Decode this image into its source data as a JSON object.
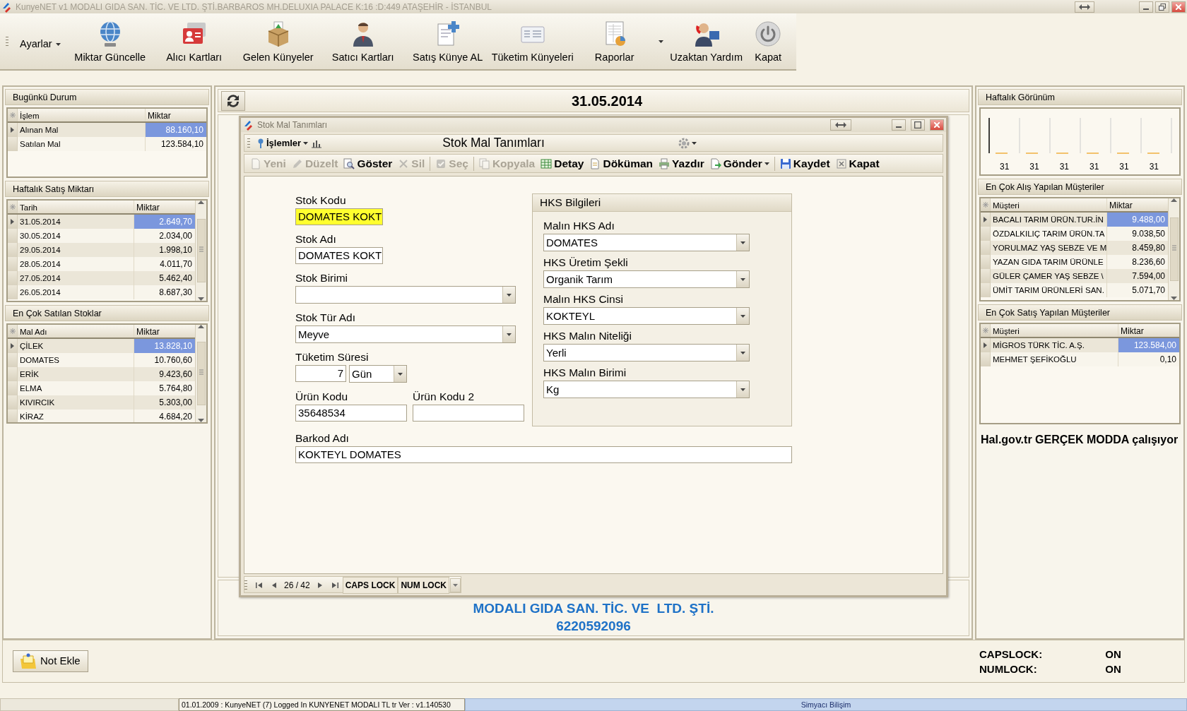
{
  "window": {
    "title": "KunyeNET v1 MODALI GIDA SAN. TİC. VE  LTD. ŞTİ.BARBAROS MH.DELUXIA PALACE K:16 :D:449 ATAŞEHİR - İSTANBUL"
  },
  "toolbar": {
    "menu": "Ayarlar",
    "buttons": [
      {
        "label": "Miktar Güncelle",
        "dropdown": false
      },
      {
        "label": "Alıcı Kartları",
        "dropdown": false
      },
      {
        "label": "Gelen Künyeler",
        "dropdown": false
      },
      {
        "label": "Satıcı Kartları",
        "dropdown": false
      },
      {
        "label": "Satış Künye AL",
        "dropdown": false
      },
      {
        "label": "Tüketim Künyeleri",
        "dropdown": false
      },
      {
        "label": "Raporlar",
        "dropdown": true
      },
      {
        "label": "Uzaktan Yardım",
        "dropdown": false
      },
      {
        "label": "Kapat",
        "dropdown": false
      }
    ]
  },
  "left_panels": [
    {
      "title": "Bugünkü Durum",
      "kind": "plain",
      "columns": [
        "İşlem",
        "Miktar"
      ],
      "rows": [
        {
          "cells": [
            "Alınan Mal",
            "88.160,10"
          ],
          "selected": true
        },
        {
          "cells": [
            "Satılan Mal",
            "123.584,10"
          ],
          "selected": false
        }
      ]
    },
    {
      "title": "Haftalık Satış Miktarı",
      "kind": "scrolled",
      "columns": [
        "Tarih",
        "Miktar"
      ],
      "rows": [
        {
          "cells": [
            "31.05.2014",
            "2.649,70"
          ],
          "selected": true
        },
        {
          "cells": [
            "30.05.2014",
            "2.034,00"
          ],
          "selected": false
        },
        {
          "cells": [
            "29.05.2014",
            "1.998,10"
          ],
          "selected": false
        },
        {
          "cells": [
            "28.05.2014",
            "4.011,70"
          ],
          "selected": false
        },
        {
          "cells": [
            "27.05.2014",
            "5.462,40"
          ],
          "selected": false
        },
        {
          "cells": [
            "26.05.2014",
            "8.687,30"
          ],
          "selected": false
        }
      ]
    },
    {
      "title": "En Çok Satılan Stoklar",
      "kind": "scrolled",
      "columns": [
        "Mal Adı",
        "Miktar"
      ],
      "rows": [
        {
          "cells": [
            "ÇİLEK",
            "13.828,10"
          ],
          "selected": true
        },
        {
          "cells": [
            "DOMATES",
            "10.760,60"
          ],
          "selected": false
        },
        {
          "cells": [
            "ERİK",
            "9.423,60"
          ],
          "selected": false
        },
        {
          "cells": [
            "ELMA",
            "5.764,80"
          ],
          "selected": false
        },
        {
          "cells": [
            "KIVIRCIK",
            "5.303,00"
          ],
          "selected": false
        },
        {
          "cells": [
            "KİRAZ",
            "4.684,20"
          ],
          "selected": false
        }
      ]
    }
  ],
  "center": {
    "date": "31.05.2014",
    "company": "MODALI GIDA SAN. TİC. VE  LTD. ŞTİ.",
    "phone": "6220592096"
  },
  "dialog": {
    "title": "Stok Mal Tanımları",
    "menu": "İşlemler",
    "heading": "Stok Mal Tanımları",
    "action_groups": [
      [
        {
          "label": "Yeni",
          "disabled": true,
          "dropdown": false
        },
        {
          "label": "Düzelt",
          "disabled": true,
          "dropdown": false
        },
        {
          "label": "Göster",
          "disabled": false,
          "dropdown": false
        },
        {
          "label": "Sil",
          "disabled": true,
          "dropdown": false
        }
      ],
      [
        {
          "label": "Seç",
          "disabled": true,
          "dropdown": false
        }
      ],
      [
        {
          "label": "Kopyala",
          "disabled": true,
          "dropdown": false
        },
        {
          "label": "Detay",
          "disabled": false,
          "dropdown": false
        },
        {
          "label": "Döküman",
          "disabled": false,
          "dropdown": false
        },
        {
          "label": "Yazdır",
          "disabled": false,
          "dropdown": false
        },
        {
          "label": "Gönder",
          "disabled": false,
          "dropdown": true
        }
      ],
      [
        {
          "label": "Kaydet",
          "disabled": false,
          "dropdown": false
        },
        {
          "label": "Kapat",
          "disabled": false,
          "dropdown": false
        }
      ]
    ],
    "form": {
      "stok_kodu": {
        "label": "Stok Kodu",
        "value": "DOMATES KOKT",
        "focused": true
      },
      "stok_adi": {
        "label": "Stok Adı",
        "value": "DOMATES KOKT",
        "focused": false
      },
      "stok_birimi": {
        "label": "Stok Birimi",
        "focused": false
      },
      "stok_tur_adi": {
        "label": "Stok Tür Adı",
        "value": "Meyve",
        "focused": false
      },
      "tuketim_suresi": {
        "label": "Tüketim Süresi",
        "value": "7",
        "unit": "Gün",
        "focused": false
      },
      "urun_kodu": {
        "label": "Ürün Kodu",
        "value": "35648534",
        "focused": false
      },
      "urun_kodu_2": {
        "label": "Ürün Kodu 2",
        "focused": false
      },
      "barkod_adi": {
        "label": "Barkod Adı",
        "value": "KOKTEYL DOMATES",
        "focused": false
      }
    },
    "hks": {
      "title": "HKS Bilgileri",
      "fields": [
        {
          "label": "Malın HKS Adı",
          "value": "DOMATES"
        },
        {
          "label": "HKS Üretim Şekli",
          "value": "Organik Tarım"
        },
        {
          "label": "Malın HKS Cinsi",
          "value": "KOKTEYL"
        },
        {
          "label": "HKS Malın Niteliği",
          "value": "Yerli"
        },
        {
          "label": "HKS Malın Birimi",
          "value": "Kg"
        }
      ]
    },
    "navigator": {
      "position": "26 / 42",
      "keys": [
        "CAPS LOCK",
        "NUM LOCK"
      ]
    }
  },
  "right": {
    "weekly": {
      "title": "Haftalık Görünüm",
      "labels": [
        "31",
        "31",
        "31",
        "31",
        "31",
        "31"
      ]
    },
    "panels": [
      {
        "title": "En Çok Alış Yapılan Müşteriler",
        "kind": "scrolled",
        "columns": [
          "Müşteri",
          "Miktar"
        ],
        "rows": [
          {
            "cells": [
              "BACALI TARIM ÜRÜN.TUR.İN",
              "9.488,00"
            ],
            "selected": true
          },
          {
            "cells": [
              "ÖZDALKILIÇ TARIM ÜRÜN.TA",
              "9.038,50"
            ],
            "selected": false
          },
          {
            "cells": [
              "YORULMAZ YAŞ SEBZE VE M",
              "8.459,80"
            ],
            "selected": false
          },
          {
            "cells": [
              "YAZAN GIDA TARIM ÜRÜNLE",
              "8.236,60"
            ],
            "selected": false
          },
          {
            "cells": [
              "GÜLER ÇAMER YAŞ SEBZE \\",
              "7.594,00"
            ],
            "selected": false
          },
          {
            "cells": [
              "ÜMİT TARIM ÜRÜNLERİ SAN.",
              "5.071,70"
            ],
            "selected": false
          }
        ]
      },
      {
        "title": "En Çok Satış Yapılan Müşteriler",
        "kind": "plain",
        "columns": [
          "Müşteri",
          "Miktar"
        ],
        "rows": [
          {
            "cells": [
              "MİGROS TÜRK TİC. A.Ş.",
              "123.584,00"
            ],
            "selected": true
          },
          {
            "cells": [
              "MEHMET ŞEFİKOĞLU",
              "0,10"
            ],
            "selected": false
          }
        ]
      }
    ],
    "message": "Hal.gov.tr GERÇEK MODDA çalışıyor"
  },
  "bottom": {
    "note_button": "Not Ekle",
    "locks": [
      {
        "label": "CAPSLOCK:",
        "value": "ON"
      },
      {
        "label": "NUMLOCK:",
        "value": "ON"
      }
    ]
  },
  "status_bar": {
    "login": "01.01.2009 : KunyeNET (7) Logged In KUNYENET MODALI TL tr Ver : v1.140530",
    "vendor": "Simyacı Bilişim"
  }
}
